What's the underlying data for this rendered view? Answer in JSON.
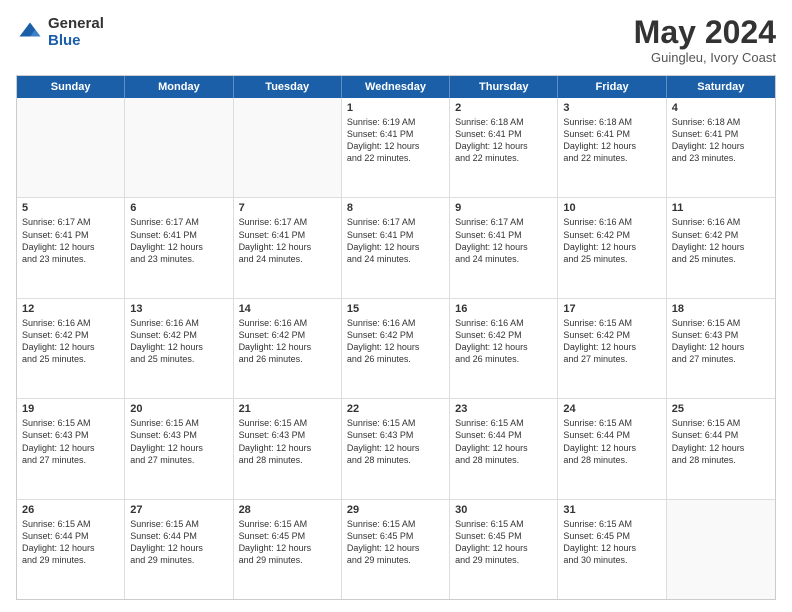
{
  "logo": {
    "general": "General",
    "blue": "Blue"
  },
  "header": {
    "month": "May 2024",
    "location": "Guingleu, Ivory Coast"
  },
  "weekdays": [
    "Sunday",
    "Monday",
    "Tuesday",
    "Wednesday",
    "Thursday",
    "Friday",
    "Saturday"
  ],
  "rows": [
    [
      {
        "day": "",
        "lines": [],
        "empty": true
      },
      {
        "day": "",
        "lines": [],
        "empty": true
      },
      {
        "day": "",
        "lines": [],
        "empty": true
      },
      {
        "day": "1",
        "lines": [
          "Sunrise: 6:19 AM",
          "Sunset: 6:41 PM",
          "Daylight: 12 hours",
          "and 22 minutes."
        ]
      },
      {
        "day": "2",
        "lines": [
          "Sunrise: 6:18 AM",
          "Sunset: 6:41 PM",
          "Daylight: 12 hours",
          "and 22 minutes."
        ]
      },
      {
        "day": "3",
        "lines": [
          "Sunrise: 6:18 AM",
          "Sunset: 6:41 PM",
          "Daylight: 12 hours",
          "and 22 minutes."
        ]
      },
      {
        "day": "4",
        "lines": [
          "Sunrise: 6:18 AM",
          "Sunset: 6:41 PM",
          "Daylight: 12 hours",
          "and 23 minutes."
        ]
      }
    ],
    [
      {
        "day": "5",
        "lines": [
          "Sunrise: 6:17 AM",
          "Sunset: 6:41 PM",
          "Daylight: 12 hours",
          "and 23 minutes."
        ]
      },
      {
        "day": "6",
        "lines": [
          "Sunrise: 6:17 AM",
          "Sunset: 6:41 PM",
          "Daylight: 12 hours",
          "and 23 minutes."
        ]
      },
      {
        "day": "7",
        "lines": [
          "Sunrise: 6:17 AM",
          "Sunset: 6:41 PM",
          "Daylight: 12 hours",
          "and 24 minutes."
        ]
      },
      {
        "day": "8",
        "lines": [
          "Sunrise: 6:17 AM",
          "Sunset: 6:41 PM",
          "Daylight: 12 hours",
          "and 24 minutes."
        ]
      },
      {
        "day": "9",
        "lines": [
          "Sunrise: 6:17 AM",
          "Sunset: 6:41 PM",
          "Daylight: 12 hours",
          "and 24 minutes."
        ]
      },
      {
        "day": "10",
        "lines": [
          "Sunrise: 6:16 AM",
          "Sunset: 6:42 PM",
          "Daylight: 12 hours",
          "and 25 minutes."
        ]
      },
      {
        "day": "11",
        "lines": [
          "Sunrise: 6:16 AM",
          "Sunset: 6:42 PM",
          "Daylight: 12 hours",
          "and 25 minutes."
        ]
      }
    ],
    [
      {
        "day": "12",
        "lines": [
          "Sunrise: 6:16 AM",
          "Sunset: 6:42 PM",
          "Daylight: 12 hours",
          "and 25 minutes."
        ]
      },
      {
        "day": "13",
        "lines": [
          "Sunrise: 6:16 AM",
          "Sunset: 6:42 PM",
          "Daylight: 12 hours",
          "and 25 minutes."
        ]
      },
      {
        "day": "14",
        "lines": [
          "Sunrise: 6:16 AM",
          "Sunset: 6:42 PM",
          "Daylight: 12 hours",
          "and 26 minutes."
        ]
      },
      {
        "day": "15",
        "lines": [
          "Sunrise: 6:16 AM",
          "Sunset: 6:42 PM",
          "Daylight: 12 hours",
          "and 26 minutes."
        ]
      },
      {
        "day": "16",
        "lines": [
          "Sunrise: 6:16 AM",
          "Sunset: 6:42 PM",
          "Daylight: 12 hours",
          "and 26 minutes."
        ]
      },
      {
        "day": "17",
        "lines": [
          "Sunrise: 6:15 AM",
          "Sunset: 6:42 PM",
          "Daylight: 12 hours",
          "and 27 minutes."
        ]
      },
      {
        "day": "18",
        "lines": [
          "Sunrise: 6:15 AM",
          "Sunset: 6:43 PM",
          "Daylight: 12 hours",
          "and 27 minutes."
        ]
      }
    ],
    [
      {
        "day": "19",
        "lines": [
          "Sunrise: 6:15 AM",
          "Sunset: 6:43 PM",
          "Daylight: 12 hours",
          "and 27 minutes."
        ]
      },
      {
        "day": "20",
        "lines": [
          "Sunrise: 6:15 AM",
          "Sunset: 6:43 PM",
          "Daylight: 12 hours",
          "and 27 minutes."
        ]
      },
      {
        "day": "21",
        "lines": [
          "Sunrise: 6:15 AM",
          "Sunset: 6:43 PM",
          "Daylight: 12 hours",
          "and 28 minutes."
        ]
      },
      {
        "day": "22",
        "lines": [
          "Sunrise: 6:15 AM",
          "Sunset: 6:43 PM",
          "Daylight: 12 hours",
          "and 28 minutes."
        ]
      },
      {
        "day": "23",
        "lines": [
          "Sunrise: 6:15 AM",
          "Sunset: 6:44 PM",
          "Daylight: 12 hours",
          "and 28 minutes."
        ]
      },
      {
        "day": "24",
        "lines": [
          "Sunrise: 6:15 AM",
          "Sunset: 6:44 PM",
          "Daylight: 12 hours",
          "and 28 minutes."
        ]
      },
      {
        "day": "25",
        "lines": [
          "Sunrise: 6:15 AM",
          "Sunset: 6:44 PM",
          "Daylight: 12 hours",
          "and 28 minutes."
        ]
      }
    ],
    [
      {
        "day": "26",
        "lines": [
          "Sunrise: 6:15 AM",
          "Sunset: 6:44 PM",
          "Daylight: 12 hours",
          "and 29 minutes."
        ]
      },
      {
        "day": "27",
        "lines": [
          "Sunrise: 6:15 AM",
          "Sunset: 6:44 PM",
          "Daylight: 12 hours",
          "and 29 minutes."
        ]
      },
      {
        "day": "28",
        "lines": [
          "Sunrise: 6:15 AM",
          "Sunset: 6:45 PM",
          "Daylight: 12 hours",
          "and 29 minutes."
        ]
      },
      {
        "day": "29",
        "lines": [
          "Sunrise: 6:15 AM",
          "Sunset: 6:45 PM",
          "Daylight: 12 hours",
          "and 29 minutes."
        ]
      },
      {
        "day": "30",
        "lines": [
          "Sunrise: 6:15 AM",
          "Sunset: 6:45 PM",
          "Daylight: 12 hours",
          "and 29 minutes."
        ]
      },
      {
        "day": "31",
        "lines": [
          "Sunrise: 6:15 AM",
          "Sunset: 6:45 PM",
          "Daylight: 12 hours",
          "and 30 minutes."
        ]
      },
      {
        "day": "",
        "lines": [],
        "empty": true
      }
    ]
  ]
}
